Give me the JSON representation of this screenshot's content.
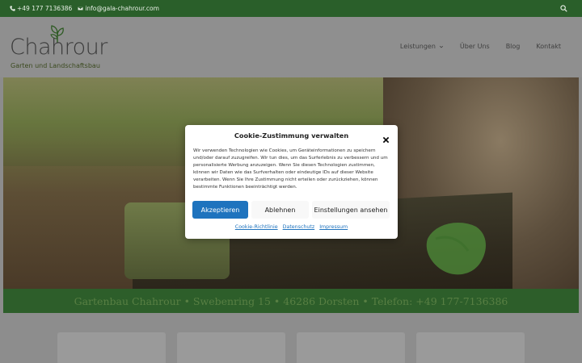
{
  "topbar": {
    "phone": "+49 177 7136386",
    "email": "info@gala-chahrour.com"
  },
  "logo": {
    "name": "Chahrour",
    "tagline": "Garten und Landschaftsbau"
  },
  "nav": {
    "items": [
      {
        "label": "Leistungen",
        "has_dropdown": true
      },
      {
        "label": "Über Uns"
      },
      {
        "label": "Blog"
      },
      {
        "label": "Kontakt"
      }
    ]
  },
  "address_strip": {
    "text": "Gartenbau Chahrour • Swebenring 15 • 46286 Dorsten • Telefon: +49 177-7136386"
  },
  "cookie_modal": {
    "title": "Cookie-Zustimmung verwalten",
    "body": "Wir verwenden Technologien wie Cookies, um Geräteinformationen zu speichern und/oder darauf zuzugreifen. Wir tun dies, um das Surferlebnis zu verbessern und um personalisierte Werbung anzuzeigen. Wenn Sie diesen Technologien zustimmen, können wir Daten wie das Surfverhalten oder eindeutige IDs auf dieser Website verarbeiten. Wenn Sie Ihre Zustimmung nicht erteilen oder zurückziehen, können bestimmte Funktionen beeinträchtigt werden.",
    "accept_label": "Akzeptieren",
    "deny_label": "Ablehnen",
    "settings_label": "Einstellungen ansehen",
    "links": [
      "Cookie-Richtlinie",
      "Datenschutz",
      "Impressum"
    ]
  },
  "colors": {
    "brand_green": "#2a5f2a",
    "accept_blue": "#1e73be"
  }
}
